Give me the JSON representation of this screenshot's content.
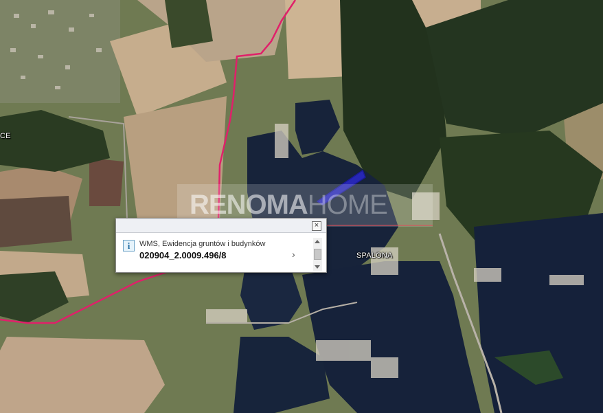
{
  "map": {
    "labels": {
      "town_partial": "CE",
      "lake_area": "SPALONA"
    },
    "watermark": {
      "part1": "RENOMA",
      "part2": "HOME"
    },
    "colors": {
      "boundary_line": "#e0206a",
      "parcel_highlight": "#1a1a9a",
      "water": "#17233a",
      "forest": "#1f2f1a",
      "field_light": "#b9a48a"
    }
  },
  "popup": {
    "layer_name": "WMS, Ewidencja gruntów i budynków",
    "parcel_id": "020904_2.0009.496/8",
    "close_icon": "close-icon",
    "info_icon": "info-icon",
    "next_icon": "chevron-right-icon"
  }
}
